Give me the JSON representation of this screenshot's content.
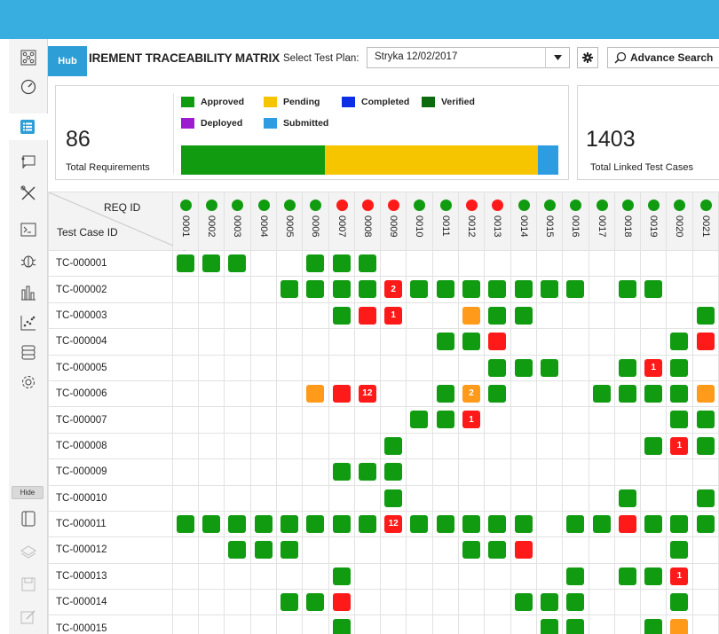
{
  "app": {
    "hub_label": "Hub",
    "page_title": "IREMENT TRACEABILITY MATRIX"
  },
  "toolbar": {
    "plan_label": "Select Test Plan:",
    "plan_value": "Stryka 12/02/2017",
    "advance_search_label": "Advance Search"
  },
  "sidebar": {
    "hide_label": "Hide",
    "items": [
      "network-icon",
      "dashboard-gauge-icon",
      "list-icon",
      "presentation-board-icon",
      "tools-icon",
      "terminal-icon",
      "bug-icon",
      "bar-chart-icon",
      "scatter-chart-icon",
      "database-icon",
      "settings-gear-icon",
      "panel-icon",
      "layers-icon",
      "save-icon",
      "edit-icon"
    ]
  },
  "summary": {
    "total_requirements": "86",
    "total_requirements_label": "Total Requirements",
    "total_linked": "1403",
    "total_linked_label": "Total Linked Test Cases",
    "legend": [
      {
        "label": "Approved",
        "color": "#119b11"
      },
      {
        "label": "Pending",
        "color": "#f7c400"
      },
      {
        "label": "Completed",
        "color": "#0b2ee6"
      },
      {
        "label": "Verified",
        "color": "#0e6a0e"
      },
      {
        "label": "Deployed",
        "color": "#9c1ccf"
      },
      {
        "label": "Submitted",
        "color": "#2d9ce0"
      }
    ],
    "status_fractions": [
      {
        "status": "Approved",
        "fraction": 0.38,
        "color": "#119b11"
      },
      {
        "status": "Pending",
        "fraction": 0.565,
        "color": "#f7c400"
      },
      {
        "status": "Submitted",
        "fraction": 0.055,
        "color": "#2d9ce0"
      }
    ]
  },
  "matrix": {
    "req_id_header": "REQ ID",
    "test_case_header": "Test Case ID",
    "colors": {
      "green": "#119b11",
      "red": "#ff1a1a",
      "orange": "#ff9a1a"
    },
    "requirements": [
      {
        "id": "0001",
        "status": "green"
      },
      {
        "id": "0002",
        "status": "green"
      },
      {
        "id": "0003",
        "status": "green"
      },
      {
        "id": "0004",
        "status": "green"
      },
      {
        "id": "0005",
        "status": "green"
      },
      {
        "id": "0006",
        "status": "green"
      },
      {
        "id": "0007",
        "status": "red"
      },
      {
        "id": "0008",
        "status": "red"
      },
      {
        "id": "0009",
        "status": "red"
      },
      {
        "id": "0010",
        "status": "green"
      },
      {
        "id": "0011",
        "status": "green"
      },
      {
        "id": "0012",
        "status": "red"
      },
      {
        "id": "0013",
        "status": "red"
      },
      {
        "id": "0014",
        "status": "green"
      },
      {
        "id": "0015",
        "status": "green"
      },
      {
        "id": "0016",
        "status": "green"
      },
      {
        "id": "0017",
        "status": "green"
      },
      {
        "id": "0018",
        "status": "green"
      },
      {
        "id": "0019",
        "status": "green"
      },
      {
        "id": "0020",
        "status": "green"
      },
      {
        "id": "0021",
        "status": "green"
      }
    ],
    "rows": [
      {
        "tc": "TC-000001",
        "cells": [
          "g",
          "g",
          "g",
          "",
          "",
          "g",
          "g",
          "g",
          "",
          "",
          "",
          "",
          "",
          "",
          "",
          "",
          "",
          "",
          "",
          "",
          ""
        ]
      },
      {
        "tc": "TC-000002",
        "cells": [
          "",
          "",
          "",
          "",
          "g",
          "g",
          "g",
          "g",
          "r2",
          "g",
          "g",
          "g",
          "g",
          "g",
          "g",
          "g",
          "",
          "g",
          "g",
          "",
          ""
        ]
      },
      {
        "tc": "TC-000003",
        "cells": [
          "",
          "",
          "",
          "",
          "",
          "",
          "g",
          "r",
          "r1",
          "",
          "",
          "o",
          "g",
          "g",
          "",
          "",
          "",
          "",
          "",
          "",
          "g"
        ]
      },
      {
        "tc": "TC-000004",
        "cells": [
          "",
          "",
          "",
          "",
          "",
          "",
          "",
          "",
          "",
          "",
          "g",
          "g",
          "r",
          "",
          "",
          "",
          "",
          "",
          "",
          "g",
          "r"
        ]
      },
      {
        "tc": "TC-000005",
        "cells": [
          "",
          "",
          "",
          "",
          "",
          "",
          "",
          "",
          "",
          "",
          "",
          "",
          "g",
          "g",
          "g",
          "",
          "",
          "g",
          "r1",
          "g",
          ""
        ]
      },
      {
        "tc": "TC-000006",
        "cells": [
          "",
          "",
          "",
          "",
          "",
          "o",
          "r",
          "r12",
          "",
          "",
          "g",
          "o2",
          "g",
          "",
          "",
          "",
          "g",
          "g",
          "g",
          "g",
          "o"
        ]
      },
      {
        "tc": "TC-000007",
        "cells": [
          "",
          "",
          "",
          "",
          "",
          "",
          "",
          "",
          "",
          "g",
          "g",
          "r1",
          "",
          "",
          "",
          "",
          "",
          "",
          "",
          "g",
          "g"
        ]
      },
      {
        "tc": "TC-000008",
        "cells": [
          "",
          "",
          "",
          "",
          "",
          "",
          "",
          "",
          "g",
          "",
          "",
          "",
          "",
          "",
          "",
          "",
          "",
          "",
          "g",
          "r1",
          "g"
        ]
      },
      {
        "tc": "TC-000009",
        "cells": [
          "",
          "",
          "",
          "",
          "",
          "",
          "g",
          "g",
          "g",
          "",
          "",
          "",
          "",
          "",
          "",
          "",
          "",
          "",
          "",
          "",
          ""
        ]
      },
      {
        "tc": "TC-000010",
        "cells": [
          "",
          "",
          "",
          "",
          "",
          "",
          "",
          "",
          "g",
          "",
          "",
          "",
          "",
          "",
          "",
          "",
          "",
          "g",
          "",
          "",
          "g"
        ]
      },
      {
        "tc": "TC-000011",
        "cells": [
          "g",
          "g",
          "g",
          "g",
          "g",
          "g",
          "g",
          "g",
          "r12",
          "g",
          "g",
          "g",
          "g",
          "g",
          "",
          "g",
          "g",
          "r",
          "g",
          "g",
          "g"
        ]
      },
      {
        "tc": "TC-000012",
        "cells": [
          "",
          "",
          "g",
          "g",
          "g",
          "",
          "",
          "",
          "",
          "",
          "",
          "g",
          "g",
          "r",
          "",
          "",
          "",
          "",
          "",
          "g",
          ""
        ]
      },
      {
        "tc": "TC-000013",
        "cells": [
          "",
          "",
          "",
          "",
          "",
          "",
          "g",
          "",
          "",
          "",
          "",
          "",
          "",
          "",
          "",
          "g",
          "",
          "g",
          "g",
          "r1",
          ""
        ]
      },
      {
        "tc": "TC-000014",
        "cells": [
          "",
          "",
          "",
          "",
          "g",
          "g",
          "r",
          "",
          "",
          "",
          "",
          "",
          "",
          "g",
          "g",
          "g",
          "",
          "",
          "",
          "g",
          ""
        ]
      },
      {
        "tc": "TC-000015",
        "cells": [
          "",
          "",
          "",
          "",
          "",
          "",
          "g",
          "",
          "",
          "",
          "",
          "",
          "",
          "",
          "g",
          "g",
          "",
          "",
          "g",
          "o",
          ""
        ]
      }
    ]
  }
}
